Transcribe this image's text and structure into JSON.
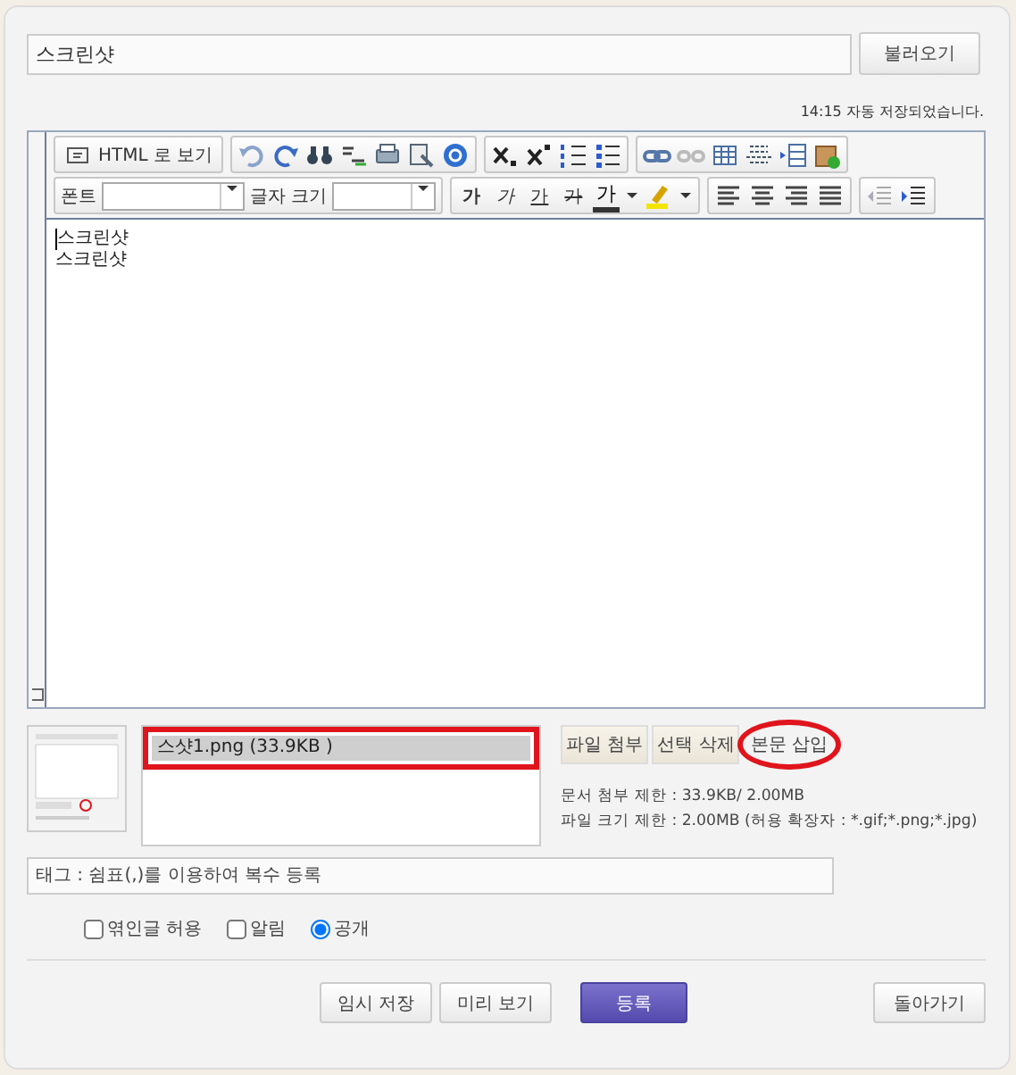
{
  "title_field": {
    "value": "스크린샷"
  },
  "load_button": "불러오기",
  "autosave_status": "14:15 자동 저장되었습니다.",
  "toolbar": {
    "html_button": "HTML 로 보기",
    "font_label": "폰트",
    "size_label": "글자 크기",
    "text_styles": [
      {
        "kind": "bold",
        "label": "가"
      },
      {
        "kind": "italic",
        "label": "가"
      },
      {
        "kind": "underline",
        "label": "가"
      },
      {
        "kind": "strike",
        "label": "가"
      }
    ],
    "font_color": "가"
  },
  "body_lines": [
    "스크린샷",
    "스크린샷"
  ],
  "attachments": [
    {
      "name": "스샷1.png (33.9KB )",
      "selected": true,
      "boxed": true
    }
  ],
  "attach_buttons": [
    {
      "label": "파일 첨부",
      "circled": false
    },
    {
      "label": "선택 삭제",
      "circled": false
    },
    {
      "label": "본문 삽입",
      "circled": true
    }
  ],
  "limits": [
    "문서 첨부 제한 : 33.9KB/ 2.00MB",
    "파일 크기 제한 : 2.00MB (허용 확장자 : *.gif;*.png;*.jpg)"
  ],
  "tag_field": {
    "placeholder": "태그 : 쉼표(,)를 이용하여 복수 등록"
  },
  "options": [
    {
      "kind": "checkbox",
      "label": "엮인글 허용",
      "checked": false
    },
    {
      "kind": "checkbox",
      "label": "알림",
      "checked": false
    },
    {
      "kind": "radio",
      "label": "공개",
      "checked": true
    }
  ],
  "actions": [
    {
      "kind": "normal",
      "label": "임시 저장"
    },
    {
      "kind": "normal",
      "label": "미리 보기"
    },
    {
      "kind": "primary",
      "label": "등록"
    }
  ],
  "back_button": "돌아가기"
}
